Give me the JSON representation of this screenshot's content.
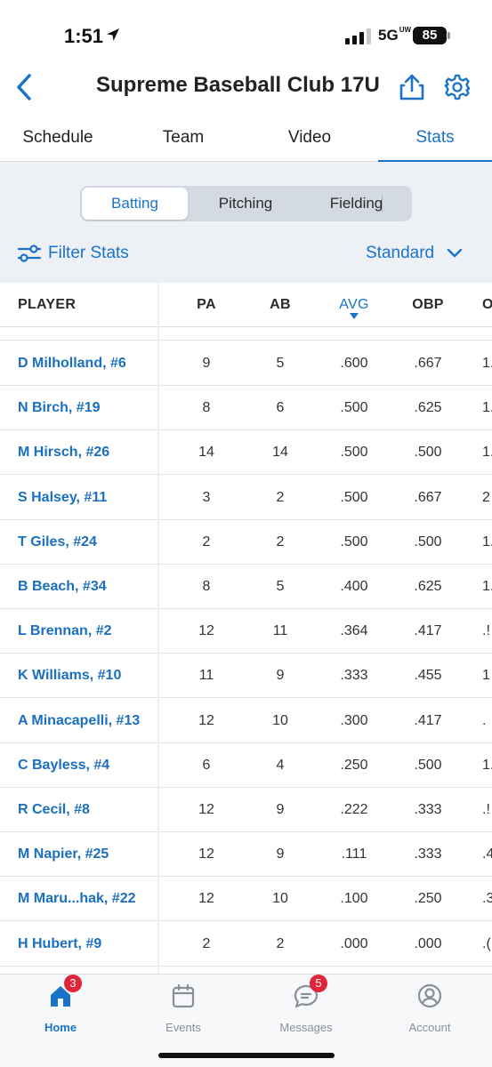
{
  "status_bar": {
    "time": "1:51",
    "network": "5G",
    "network_sup": "UW",
    "battery": "85"
  },
  "header": {
    "title": "Supreme Baseball Club 17U"
  },
  "tabs": [
    {
      "label": "Schedule"
    },
    {
      "label": "Team"
    },
    {
      "label": "Video"
    },
    {
      "label": "Stats"
    }
  ],
  "segmented": {
    "batting": "Batting",
    "pitching": "Pitching",
    "fielding": "Fielding",
    "selected": "Batting"
  },
  "filter": {
    "label": "Filter Stats"
  },
  "view_select": {
    "value": "Standard"
  },
  "table": {
    "headers": {
      "player": "PLAYER",
      "pa": "PA",
      "ab": "AB",
      "avg": "AVG",
      "obp": "OBP",
      "next": "O"
    },
    "sorted_column": "AVG",
    "rows": [
      {
        "player": "D Milholland, #6",
        "pa": "9",
        "ab": "5",
        "avg": ".600",
        "obp": ".667",
        "next": "1."
      },
      {
        "player": "N Birch, #19",
        "pa": "8",
        "ab": "6",
        "avg": ".500",
        "obp": ".625",
        "next": "1."
      },
      {
        "player": "M Hirsch, #26",
        "pa": "14",
        "ab": "14",
        "avg": ".500",
        "obp": ".500",
        "next": "1."
      },
      {
        "player": "S Halsey, #11",
        "pa": "3",
        "ab": "2",
        "avg": ".500",
        "obp": ".667",
        "next": "2"
      },
      {
        "player": "T Giles, #24",
        "pa": "2",
        "ab": "2",
        "avg": ".500",
        "obp": ".500",
        "next": "1."
      },
      {
        "player": "B Beach, #34",
        "pa": "8",
        "ab": "5",
        "avg": ".400",
        "obp": ".625",
        "next": "1."
      },
      {
        "player": "L Brennan, #2",
        "pa": "12",
        "ab": "11",
        "avg": ".364",
        "obp": ".417",
        "next": ".!"
      },
      {
        "player": "K Williams, #10",
        "pa": "11",
        "ab": "9",
        "avg": ".333",
        "obp": ".455",
        "next": "1"
      },
      {
        "player": "A Minacapelli, #13",
        "pa": "12",
        "ab": "10",
        "avg": ".300",
        "obp": ".417",
        "next": "."
      },
      {
        "player": "C Bayless, #4",
        "pa": "6",
        "ab": "4",
        "avg": ".250",
        "obp": ".500",
        "next": "1."
      },
      {
        "player": "R Cecil, #8",
        "pa": "12",
        "ab": "9",
        "avg": ".222",
        "obp": ".333",
        "next": ".!"
      },
      {
        "player": "M Napier, #25",
        "pa": "12",
        "ab": "9",
        "avg": ".111",
        "obp": ".333",
        "next": ".4"
      },
      {
        "player": "M Maru...hak, #22",
        "pa": "12",
        "ab": "10",
        "avg": ".100",
        "obp": ".250",
        "next": ".3"
      },
      {
        "player": "H Hubert, #9",
        "pa": "2",
        "ab": "2",
        "avg": ".000",
        "obp": ".000",
        "next": ".("
      }
    ]
  },
  "bottom_nav": [
    {
      "label": "Home",
      "badge": "3",
      "icon": "home-icon",
      "active": true
    },
    {
      "label": "Events",
      "badge": "",
      "icon": "calendar-icon",
      "active": false
    },
    {
      "label": "Messages",
      "badge": "5",
      "icon": "messages-icon",
      "active": false
    },
    {
      "label": "Account",
      "badge": "",
      "icon": "account-icon",
      "active": false
    }
  ],
  "colors": {
    "accent": "#1a73c8",
    "badge": "#e0243a",
    "controls_bg": "#edf1f6"
  }
}
